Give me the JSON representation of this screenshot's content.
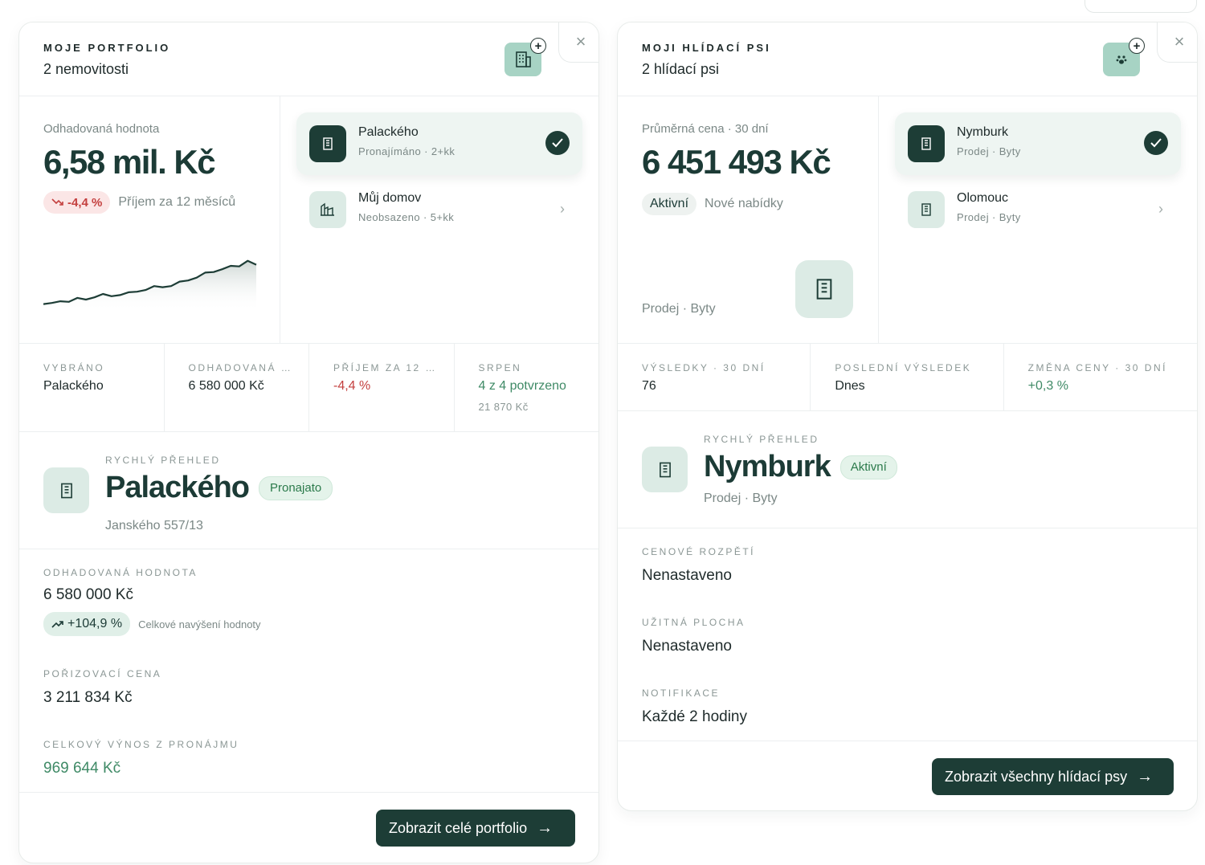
{
  "portfolio": {
    "eyebrow": "MOJE PORTFOLIO",
    "subtitle": "2 nemovitosti",
    "close_icon": "close-icon",
    "estimate": {
      "label": "Odhadovaná hodnota",
      "value": "6,58 mil. Kč",
      "change": "-4,4 %",
      "change_note": "Příjem za 12 měsíců"
    },
    "sparkline": [
      0.02,
      0.04,
      0.07,
      0.06,
      0.13,
      0.1,
      0.14,
      0.2,
      0.16,
      0.18,
      0.23,
      0.24,
      0.27,
      0.34,
      0.32,
      0.34,
      0.42,
      0.44,
      0.49,
      0.58,
      0.59,
      0.64,
      0.7,
      0.69,
      0.79,
      0.72
    ],
    "properties": [
      {
        "name": "Palackého",
        "desc": "Pronajímáno · 2+kk",
        "selected": true
      },
      {
        "name": "Můj domov",
        "desc": "Neobsazeno · 5+kk",
        "selected": false
      }
    ],
    "stats": [
      {
        "key": "VYBRÁNO",
        "value": "Palackého",
        "tone": ""
      },
      {
        "key": "ODHADOVANÁ …",
        "value": "6 580 000 Kč",
        "tone": ""
      },
      {
        "key": "PŘÍJEM ZA 12 …",
        "value": "-4,4 %",
        "tone": "red"
      },
      {
        "key": "SRPEN",
        "value": "4 z 4 potvrzeno",
        "tone": "green",
        "sub": "21 870 Kč"
      }
    ],
    "quick": {
      "eyebrow": "RYCHLÝ PŘEHLED",
      "title": "Palackého",
      "badge": "Pronajato",
      "address": "Janského 557/13"
    },
    "est_field": {
      "key": "ODHADOVANÁ HODNOTA",
      "value": "6 580 000 Kč",
      "growth": "+104,9 %",
      "growth_note": "Celkové navýšení hodnoty"
    },
    "purchase": {
      "key": "POŘIZOVACÍ CENA",
      "value": "3 211 834 Kč"
    },
    "rent_yield": {
      "key": "CELKOVÝ VÝNOS Z PRONÁJMU",
      "value": "969 644 Kč"
    },
    "cta": "Zobrazit celé portfolio"
  },
  "watchdogs": {
    "eyebrow": "MOJI HLÍDACÍ PSI",
    "subtitle": "2 hlídací psi",
    "avg": {
      "label": "Průměrná cena · 30 dní",
      "value": "6 451 493 Kč",
      "status": "Aktivní",
      "status_note": "Nové nabídky",
      "category": "Prodej · Byty"
    },
    "items": [
      {
        "name": "Nymburk",
        "desc": "Prodej · Byty",
        "selected": true
      },
      {
        "name": "Olomouc",
        "desc": "Prodej · Byty",
        "selected": false
      }
    ],
    "stats": [
      {
        "key": "VÝSLEDKY · 30 DNÍ",
        "value": "76",
        "tone": ""
      },
      {
        "key": "POSLEDNÍ VÝSLEDEK",
        "value": "Dnes",
        "tone": ""
      },
      {
        "key": "ZMĚNA CENY · 30 DNÍ",
        "value": "+0,3 %",
        "tone": "green"
      }
    ],
    "quick": {
      "eyebrow": "RYCHLÝ PŘEHLED",
      "title": "Nymburk",
      "badge": "Aktivní",
      "category": "Prodej · Byty"
    },
    "price_range": {
      "key": "CENOVÉ ROZPĚTÍ",
      "value": "Nenastaveno"
    },
    "area": {
      "key": "UŽITNÁ PLOCHA",
      "value": "Nenastaveno"
    },
    "notify": {
      "key": "NOTIFIKACE",
      "value": "Každé 2 hodiny"
    },
    "cta": "Zobrazit všechny hlídací psy"
  },
  "colors": {
    "accent": "#1d3d36",
    "mint": "#a7d3c4",
    "negative": "#c4403f",
    "positive": "#3f8a66"
  }
}
